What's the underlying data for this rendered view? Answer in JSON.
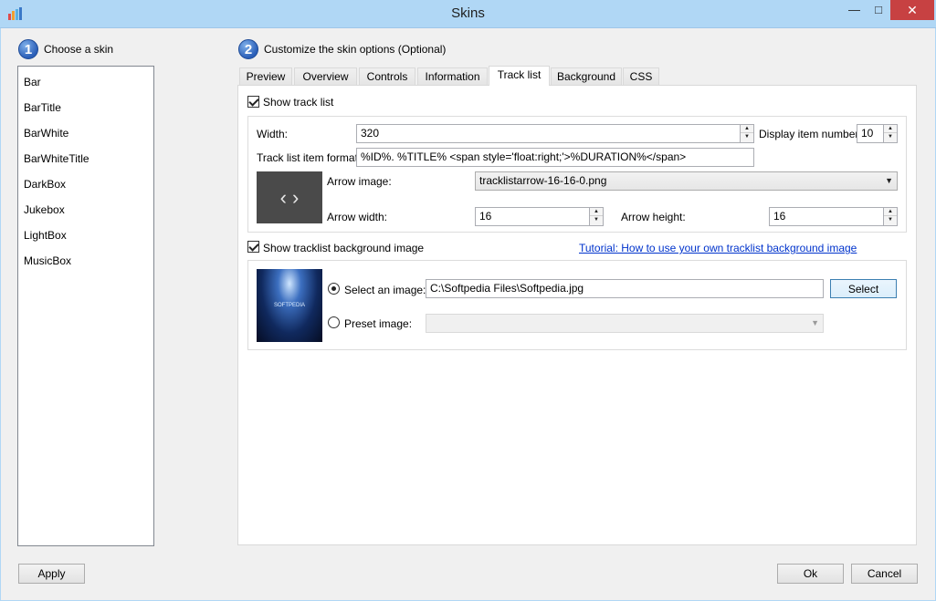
{
  "window": {
    "title": "Skins",
    "minimize_glyph": "—",
    "maximize_glyph": "□",
    "close_glyph": "✕"
  },
  "step1": {
    "number": "1",
    "label": "Choose a skin"
  },
  "step2": {
    "number": "2",
    "label": "Customize the skin options (Optional)"
  },
  "skins": [
    "Bar",
    "BarTitle",
    "BarWhite",
    "BarWhiteTitle",
    "DarkBox",
    "Jukebox",
    "LightBox",
    "MusicBox"
  ],
  "tabs": [
    "Preview",
    "Overview",
    "Controls",
    "Information",
    "Track list",
    "Background",
    "CSS"
  ],
  "active_tab": "Track list",
  "track_list": {
    "show_label": "Show track list",
    "show_checked": true,
    "width_label": "Width:",
    "width_value": "320",
    "display_item_number_label": "Display item number:",
    "display_item_number_value": "10",
    "format_label": "Track list item format:",
    "format_value": "%ID%. %TITLE% <span style='float:right;'>%DURATION%</span>",
    "arrow_image_label": "Arrow image:",
    "arrow_image_value": "tracklistarrow-16-16-0.png",
    "arrow_width_label": "Arrow width:",
    "arrow_width_value": "16",
    "arrow_height_label": "Arrow height:",
    "arrow_height_value": "16",
    "arrow_preview_glyphs": "‹ ›"
  },
  "background": {
    "show_label": "Show tracklist background image",
    "show_checked": true,
    "tutorial_link": "Tutorial: How to use your own tracklist background image",
    "select_image_label": "Select an image:",
    "select_image_path": "C:\\Softpedia Files\\Softpedia.jpg",
    "select_button": "Select",
    "preset_image_label": "Preset image:",
    "preset_value": "",
    "thumb_text": "SOFTPEDIA"
  },
  "footer": {
    "apply": "Apply",
    "ok": "Ok",
    "cancel": "Cancel"
  },
  "colors": {
    "accent": "#3c7fb1",
    "title_bar": "#b0d7f5",
    "close": "#c74142",
    "link": "#0033cc"
  }
}
